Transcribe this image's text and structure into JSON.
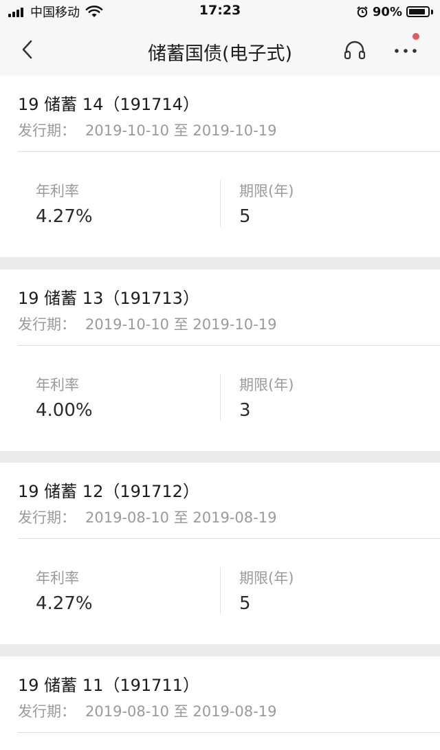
{
  "status_bar": {
    "carrier": "中国移动",
    "time": "17:23",
    "battery": "90%",
    "battery_level": 0.9,
    "icons": [
      "signal-icon",
      "wifi-icon",
      "alarm-icon",
      "battery-icon"
    ]
  },
  "nav": {
    "title": "储蓄国债(电子式)",
    "icons": [
      "back-icon",
      "headset-icon",
      "more-icon"
    ],
    "badge_color": "#e8575c"
  },
  "bonds": [
    {
      "name": "19 储蓄 14（191714）",
      "period_label": "发行期：",
      "period_dates": "2019-10-10 至 2019-10-19",
      "rate_label": "年利率",
      "rate": "4.27%",
      "term_label": "期限(年)",
      "term": "5"
    },
    {
      "name": "19 储蓄 13（191713）",
      "period_label": "发行期：",
      "period_dates": "2019-10-10 至 2019-10-19",
      "rate_label": "年利率",
      "rate": "4.00%",
      "term_label": "期限(年)",
      "term": "3"
    },
    {
      "name": "19 储蓄 12（191712）",
      "period_label": "发行期：",
      "period_dates": "2019-08-10 至 2019-08-19",
      "rate_label": "年利率",
      "rate": "4.27%",
      "term_label": "期限(年)",
      "term": "5"
    },
    {
      "name": "19 储蓄 11（191711）",
      "period_label": "发行期：",
      "period_dates": "2019-08-10 至 2019-08-19"
    }
  ]
}
